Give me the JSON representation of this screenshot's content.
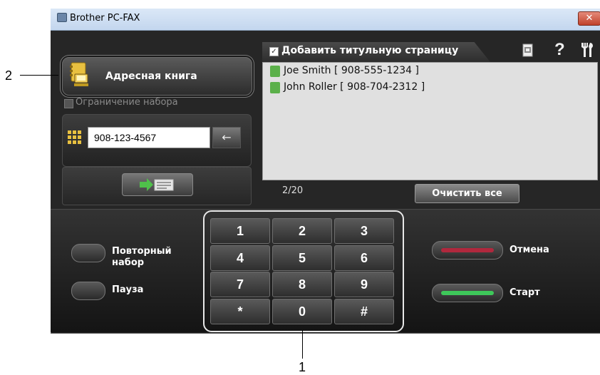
{
  "window": {
    "title": "Brother PC-FAX",
    "close_label": "✕"
  },
  "address_book": {
    "label": "Адресная книга"
  },
  "dial_limit": {
    "label": "Ограничение набора"
  },
  "number_input": {
    "value": "908-123-4567",
    "backspace_label": "←"
  },
  "recipients": {
    "cover_page_label": "Добавить титульную страницу",
    "cover_checked_mark": "✓",
    "items": [
      {
        "text": "Joe Smith [ 908-555-1234 ]"
      },
      {
        "text": "John Roller [ 908-704-2312 ]"
      }
    ],
    "count": "2/20",
    "clear_all_label": "Очистить все"
  },
  "toolbar_icons": {
    "help_label": "?"
  },
  "keypad": {
    "keys": [
      "1",
      "2",
      "3",
      "4",
      "5",
      "6",
      "7",
      "8",
      "9",
      "*",
      "0",
      "#"
    ]
  },
  "side_buttons": {
    "redial_label_line1": "Повторный",
    "redial_label_line2": "набор",
    "pause_label": "Пауза",
    "cancel_label": "Отмена",
    "start_label": "Старт",
    "cancel_color": "#b0283d",
    "start_color": "#3ec85a"
  },
  "callouts": {
    "one": "1",
    "two": "2"
  }
}
